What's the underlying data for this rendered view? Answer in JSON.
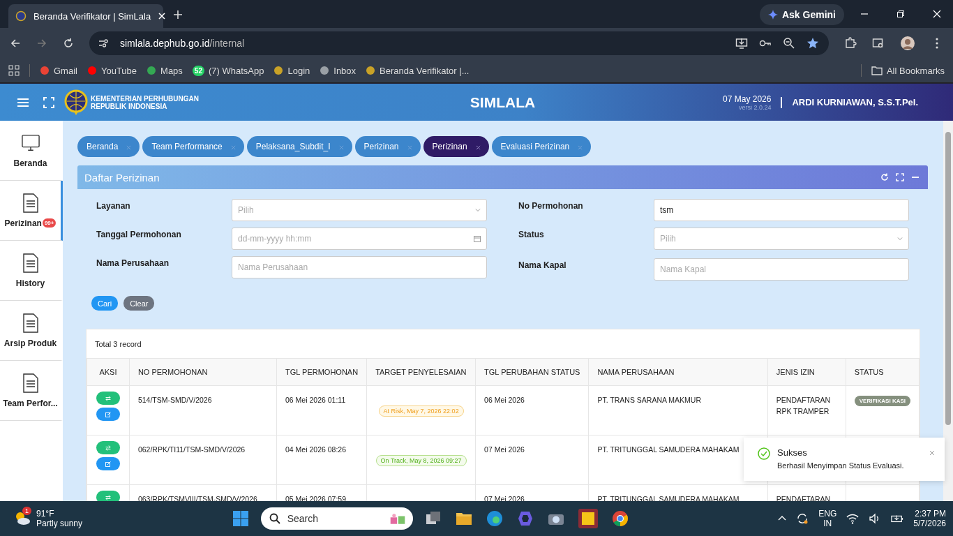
{
  "browser": {
    "tab_title": "Beranda Verifikator | SimLala",
    "url_host": "simlala.dephub.go.id",
    "url_path": "/internal",
    "ask": "Ask Gemini",
    "bookmarks": [
      {
        "label": "Gmail",
        "color": "#ea4335"
      },
      {
        "label": "YouTube",
        "color": "#ff0000"
      },
      {
        "label": "Maps",
        "color": "#34a853"
      },
      {
        "label": "(7) WhatsApp",
        "color": "#25d366",
        "badge": "52"
      },
      {
        "label": "Login",
        "color": "#c9a227"
      },
      {
        "label": "Inbox",
        "color": "#9aa0a6"
      },
      {
        "label": "Beranda Verifikator |...",
        "color": "#c9a227"
      }
    ],
    "all_bookmarks": "All Bookmarks"
  },
  "header": {
    "org_line1": "KEMENTERIAN PERHUBUNGAN",
    "org_line2": "REPUBLIK INDONESIA",
    "title": "SIMLALA",
    "date": "07 May 2026",
    "version": "versi 2.0.24",
    "user": "ARDI KURNIAWAN, S.S.T.Pel."
  },
  "sidebar": {
    "items": [
      {
        "label": "Beranda",
        "selected": false,
        "kind": "monitor"
      },
      {
        "label": "Perizinan",
        "selected": true,
        "kind": "document",
        "badge": "99+"
      },
      {
        "label": "History",
        "selected": false,
        "kind": "document"
      },
      {
        "label": "Arsip Produk",
        "selected": false,
        "kind": "document"
      },
      {
        "label": "Team Perfor...",
        "selected": false,
        "kind": "document"
      }
    ]
  },
  "breadcrumbs": [
    {
      "label": "Beranda",
      "selected": false
    },
    {
      "label": "Team Performance",
      "selected": false
    },
    {
      "label": "Pelaksana_Subdit_I",
      "selected": false
    },
    {
      "label": "Perizinan",
      "selected": false
    },
    {
      "label": "Perizinan",
      "selected": true
    },
    {
      "label": "Evaluasi Perizinan",
      "selected": false
    }
  ],
  "panel": {
    "title": "Daftar Perizinan",
    "filters_left": [
      {
        "label": "Layanan",
        "kind": "select",
        "placeholder": "Pilih"
      },
      {
        "label": "Tanggal Permohonan",
        "kind": "date",
        "placeholder": "dd-mm-yyyy hh:mm"
      },
      {
        "label": "Nama Perusahaan",
        "kind": "text",
        "placeholder": "Nama Perusahaan"
      }
    ],
    "filters_right": [
      {
        "label": "No Permohonan",
        "kind": "text",
        "value": "tsm"
      },
      {
        "label": "Status",
        "kind": "select",
        "placeholder": "Pilih"
      },
      {
        "label": "Nama Kapal",
        "kind": "text",
        "placeholder": "Nama Kapal"
      }
    ],
    "buttons": [
      {
        "label": "Cari",
        "kind": "primary"
      },
      {
        "label": "Clear",
        "kind": "secondary"
      }
    ],
    "total": "Total 3 record",
    "table": {
      "columns": [
        "AKSI",
        "NO PERMOHONAN",
        "TGL PERMOHONAN",
        "TARGET PENYELESAIAN",
        "TGL PERUBAHAN STATUS",
        "NAMA PERUSAHAAN",
        "JENIS IZIN",
        "STATUS"
      ],
      "rows": [
        {
          "no": "514/TSM-SMD/V/2026",
          "tgl": "06 Mei 2026 01:11",
          "target": {
            "text": "At Risk, May 7, 2026 22:02",
            "kind": "at_risk"
          },
          "tgl_status": "06 Mei 2026",
          "perusahaan": "PT. TRANS SARANA MAKMUR",
          "jenis": "PENDAFTARAN RPK TRAMPER",
          "status": "VERIFIKASI KASI"
        },
        {
          "no": "062/RPK/TI11/TSM-SMD/V/2026",
          "tgl": "04 Mei 2026 08:26",
          "target": {
            "text": "On Track, May 8, 2026 09:27",
            "kind": "on_track"
          },
          "tgl_status": "07 Mei 2026",
          "perusahaan": "PT. TRITUNGGAL SAMUDERA MAHAKAM"
        },
        {
          "no": "063/RPK/TSMVIII/TSM-SMD/V/2026",
          "tgl": "05 Mei 2026 07:59",
          "tgl_status": "07 Mei 2026",
          "perusahaan": "PT. TRITUNGGAL SAMUDERA MAHAKAM",
          "jenis": "PENDAFTARAN"
        }
      ]
    }
  },
  "toast": {
    "title": "Sukses",
    "message": "Berhasil Menyimpan Status Evaluasi."
  },
  "taskbar": {
    "temp": "91°F",
    "weather": "Partly sunny",
    "weather_badge": "1",
    "search": "Search",
    "lang1": "ENG",
    "lang2": "IN",
    "time": "2:37 PM",
    "date": "5/7/2026"
  }
}
